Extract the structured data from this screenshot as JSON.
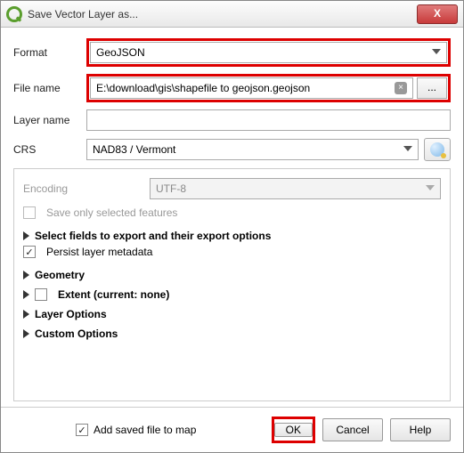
{
  "window": {
    "title": "Save Vector Layer as..."
  },
  "form": {
    "format_label": "Format",
    "format_value": "GeoJSON",
    "filename_label": "File name",
    "filename_value": "E:\\download\\gis\\shapefile to geojson.geojson",
    "browse_label": "...",
    "layername_label": "Layer name",
    "layername_value": "",
    "crs_label": "CRS",
    "crs_value": "NAD83 / Vermont"
  },
  "panel": {
    "encoding_label": "Encoding",
    "encoding_value": "UTF-8",
    "save_selected_label": "Save only selected features",
    "select_fields_label": "Select fields to export and their export options",
    "persist_metadata_label": "Persist layer metadata",
    "geometry_label": "Geometry",
    "extent_label": "Extent (current: none)",
    "layer_options_label": "Layer Options",
    "custom_options_label": "Custom Options"
  },
  "footer": {
    "add_to_map_label": "Add saved file to map",
    "ok": "OK",
    "cancel": "Cancel",
    "help": "Help"
  }
}
